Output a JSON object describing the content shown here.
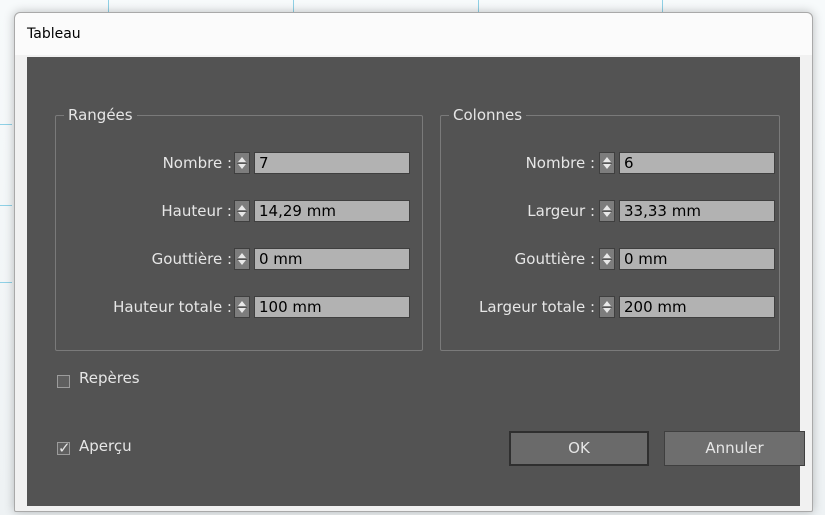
{
  "window": {
    "title": "Tableau"
  },
  "rows": {
    "title": "Rangées",
    "count_label": "Nombre :",
    "count_value": "7",
    "height_label": "Hauteur :",
    "height_value": "14,29 mm",
    "gutter_label": "Gouttière :",
    "gutter_value": "0 mm",
    "total_label": "Hauteur totale :",
    "total_value": "100 mm"
  },
  "columns": {
    "title": "Colonnes",
    "count_label": "Nombre :",
    "count_value": "6",
    "width_label": "Largeur :",
    "width_value": "33,33 mm",
    "gutter_label": "Gouttière :",
    "gutter_value": "0 mm",
    "total_label": "Largeur totale :",
    "total_value": "200 mm"
  },
  "options": {
    "guides_label": "Repères",
    "guides_checked": false,
    "preview_label": "Aperçu",
    "preview_checked": true,
    "check_glyph": "✓"
  },
  "buttons": {
    "ok_label": "OK",
    "cancel_label": "Annuler"
  },
  "colors": {
    "panel_bg": "#535353",
    "field_bg": "#b2b2b2",
    "text_light": "#e6e6e6",
    "guide_cyan": "#8fd1e6"
  }
}
